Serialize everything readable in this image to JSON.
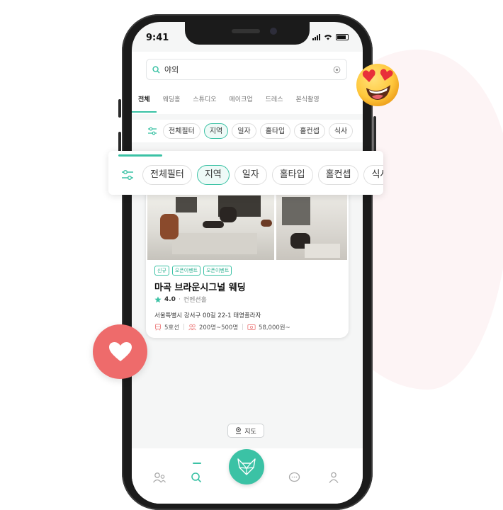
{
  "status_bar": {
    "time": "9:41"
  },
  "search": {
    "value": "야외"
  },
  "tabs": [
    {
      "label": "전체",
      "active": true
    },
    {
      "label": "웨딩홀",
      "active": false
    },
    {
      "label": "스튜디오",
      "active": false
    },
    {
      "label": "메이크업",
      "active": false
    },
    {
      "label": "드레스",
      "active": false
    },
    {
      "label": "본식촬영",
      "active": false
    }
  ],
  "filters": [
    {
      "label": "전체필터",
      "active": false
    },
    {
      "label": "지역",
      "active": true
    },
    {
      "label": "일자",
      "active": false
    },
    {
      "label": "홀타입",
      "active": false
    },
    {
      "label": "홀컨셉",
      "active": false
    },
    {
      "label": "식사",
      "active": false
    }
  ],
  "card": {
    "tags": [
      "신규",
      "오픈이벤트",
      "오픈이벤트"
    ],
    "title": "마곡 브라운시그널 웨딩",
    "rating": "4.0",
    "category": "컨벤션홀",
    "address": "서울특별시 강서구 00길 22-1 태영플라자",
    "subway": "5호선",
    "capacity": "200명~500명",
    "price": "58,000원~"
  },
  "map_button": {
    "label": "지도"
  },
  "colors": {
    "accent": "#3bc2a5",
    "heart": "#ee6b6b",
    "emoji": "#ffc83d"
  },
  "icons": [
    "search-icon",
    "clear-icon",
    "filter-icon",
    "star-icon",
    "train-icon",
    "people-icon",
    "money-icon",
    "map-pin-icon",
    "users-icon",
    "chat-icon",
    "profile-icon",
    "fox-logo-icon",
    "heart-icon",
    "heart-eyes-emoji"
  ]
}
